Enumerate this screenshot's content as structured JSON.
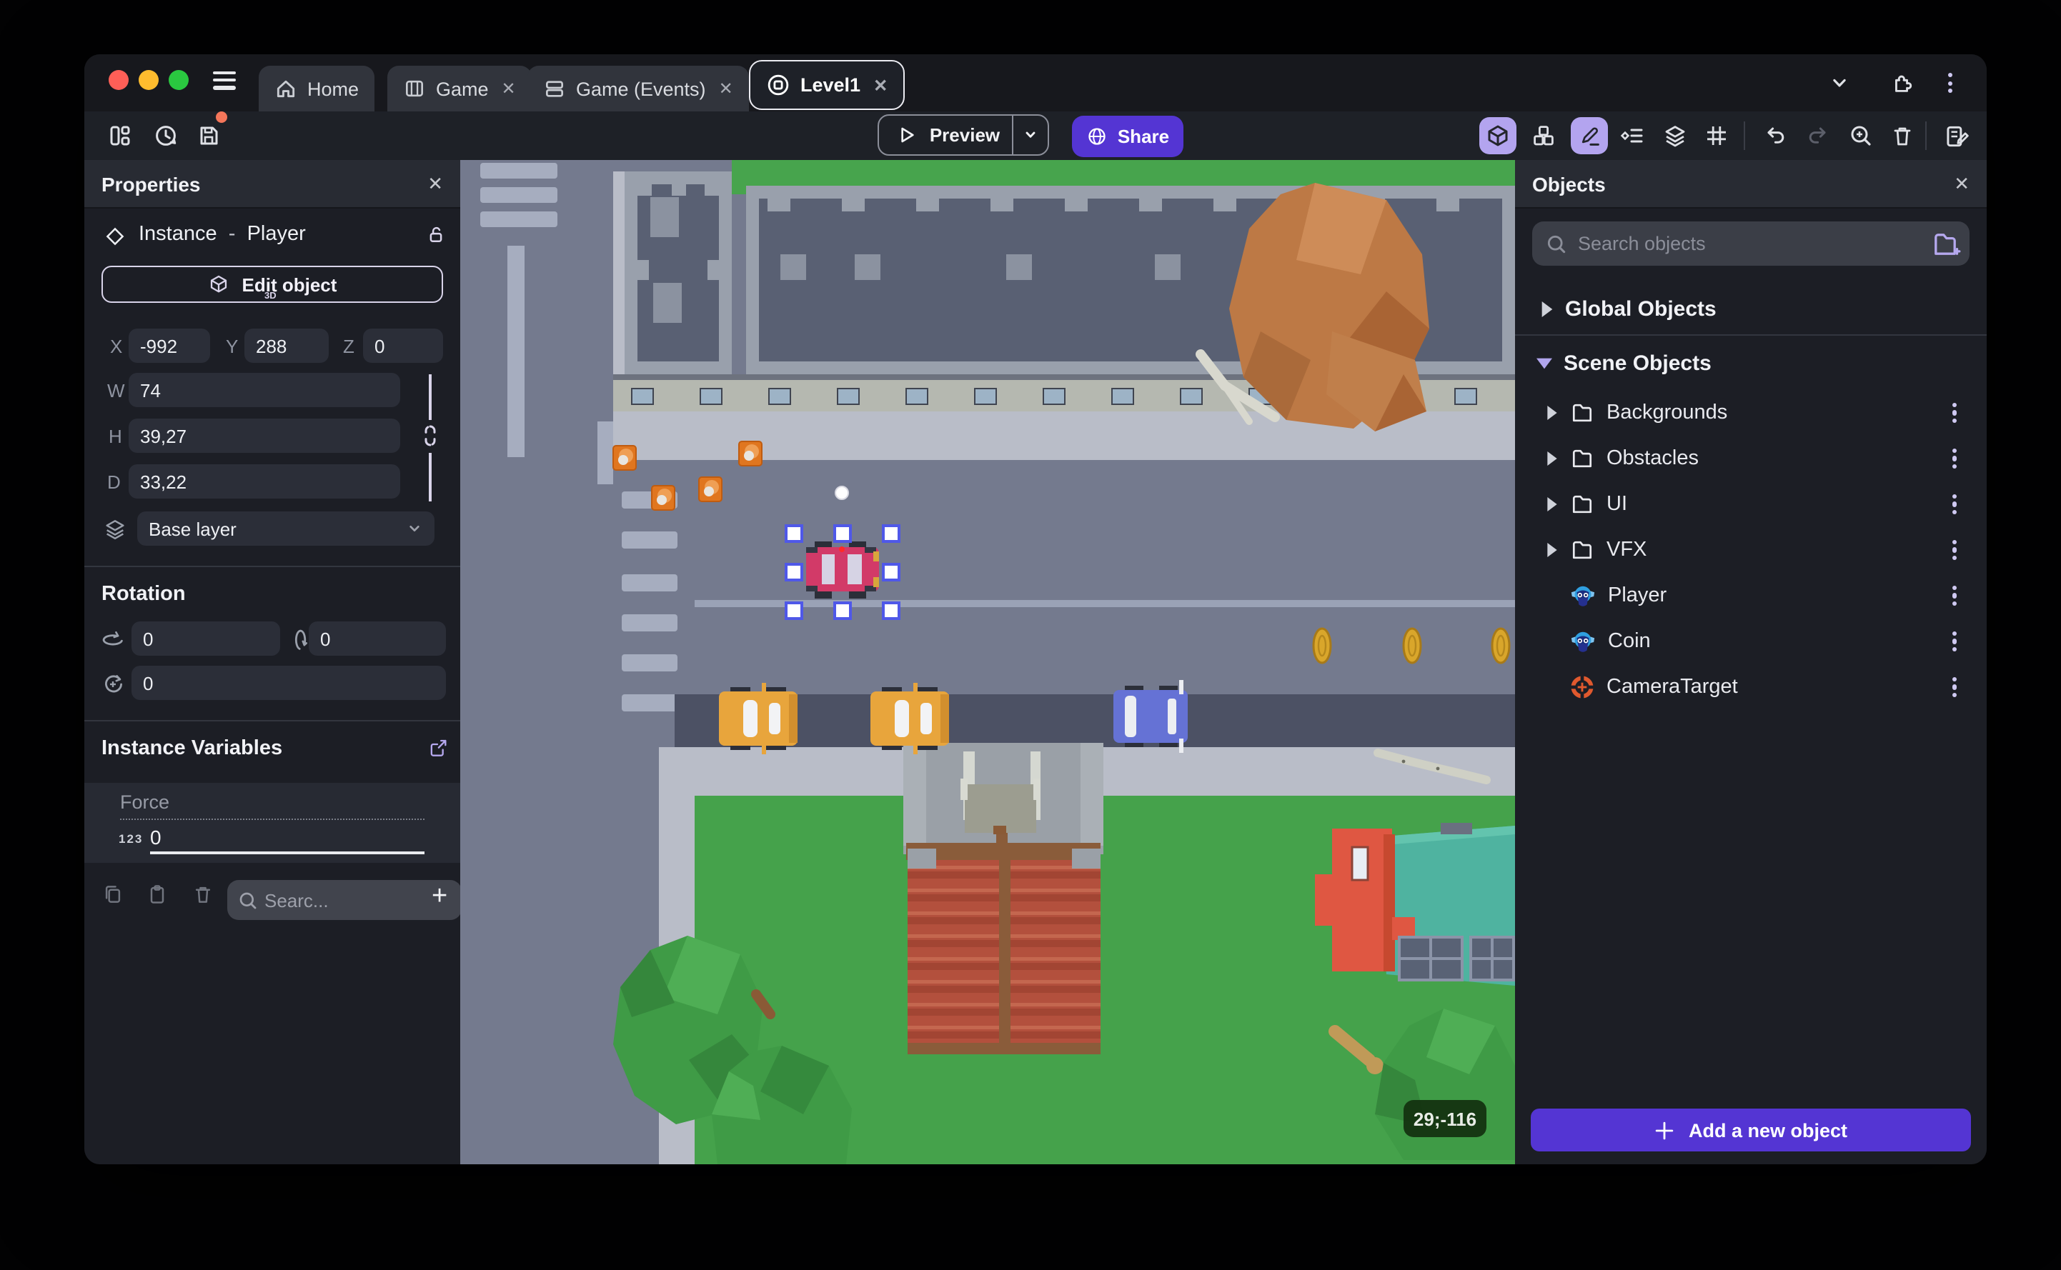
{
  "window": {
    "tabs": [
      {
        "label": "Home"
      },
      {
        "label": "Game"
      },
      {
        "label": "Game (Events)"
      },
      {
        "label": "Level1"
      }
    ],
    "close_glyph": "✕"
  },
  "toolbar": {
    "preview_label": "Preview",
    "share_label": "Share"
  },
  "properties": {
    "title": "Properties",
    "instance_label": "Instance",
    "separator": "-",
    "object_name": "Player",
    "edit_object_label": "Edit object",
    "edit_object_badge": "3D",
    "x_label": "X",
    "x_value": "-992",
    "y_label": "Y",
    "y_value": "288",
    "z_label": "Z",
    "z_value": "0",
    "w_label": "W",
    "w_value": "74",
    "h_label": "H",
    "h_value": "39,27",
    "d_label": "D",
    "d_value": "33,22",
    "layer_value": "Base layer",
    "rotation_title": "Rotation",
    "rotation_x": "0",
    "rotation_y": "0",
    "rotation_z": "0",
    "variables_title": "Instance Variables",
    "variable_name": "Force",
    "variable_type_badge": "123",
    "variable_value": "0",
    "variables_search_placeholder": "Searc..."
  },
  "scene": {
    "cursor_coordinates": "29;-116"
  },
  "objects_panel": {
    "title": "Objects",
    "search_placeholder": "Search objects",
    "global_section_label": "Global Objects",
    "scene_section_label": "Scene Objects",
    "folders": [
      {
        "name": "Backgrounds"
      },
      {
        "name": "Obstacles"
      },
      {
        "name": "UI"
      },
      {
        "name": "VFX"
      }
    ],
    "items": [
      {
        "name": "Player"
      },
      {
        "name": "Coin"
      },
      {
        "name": "CameraTarget"
      }
    ],
    "add_button_label": "Add a new object"
  },
  "colors": {
    "accent_purple": "#5435d3",
    "accent_light_purple": "#b3a4ef",
    "selection_blue": "#4f58e8",
    "save_alert_orange": "#f4765a",
    "grass_green": "#45a24b",
    "road_grey": "#747a8e"
  }
}
